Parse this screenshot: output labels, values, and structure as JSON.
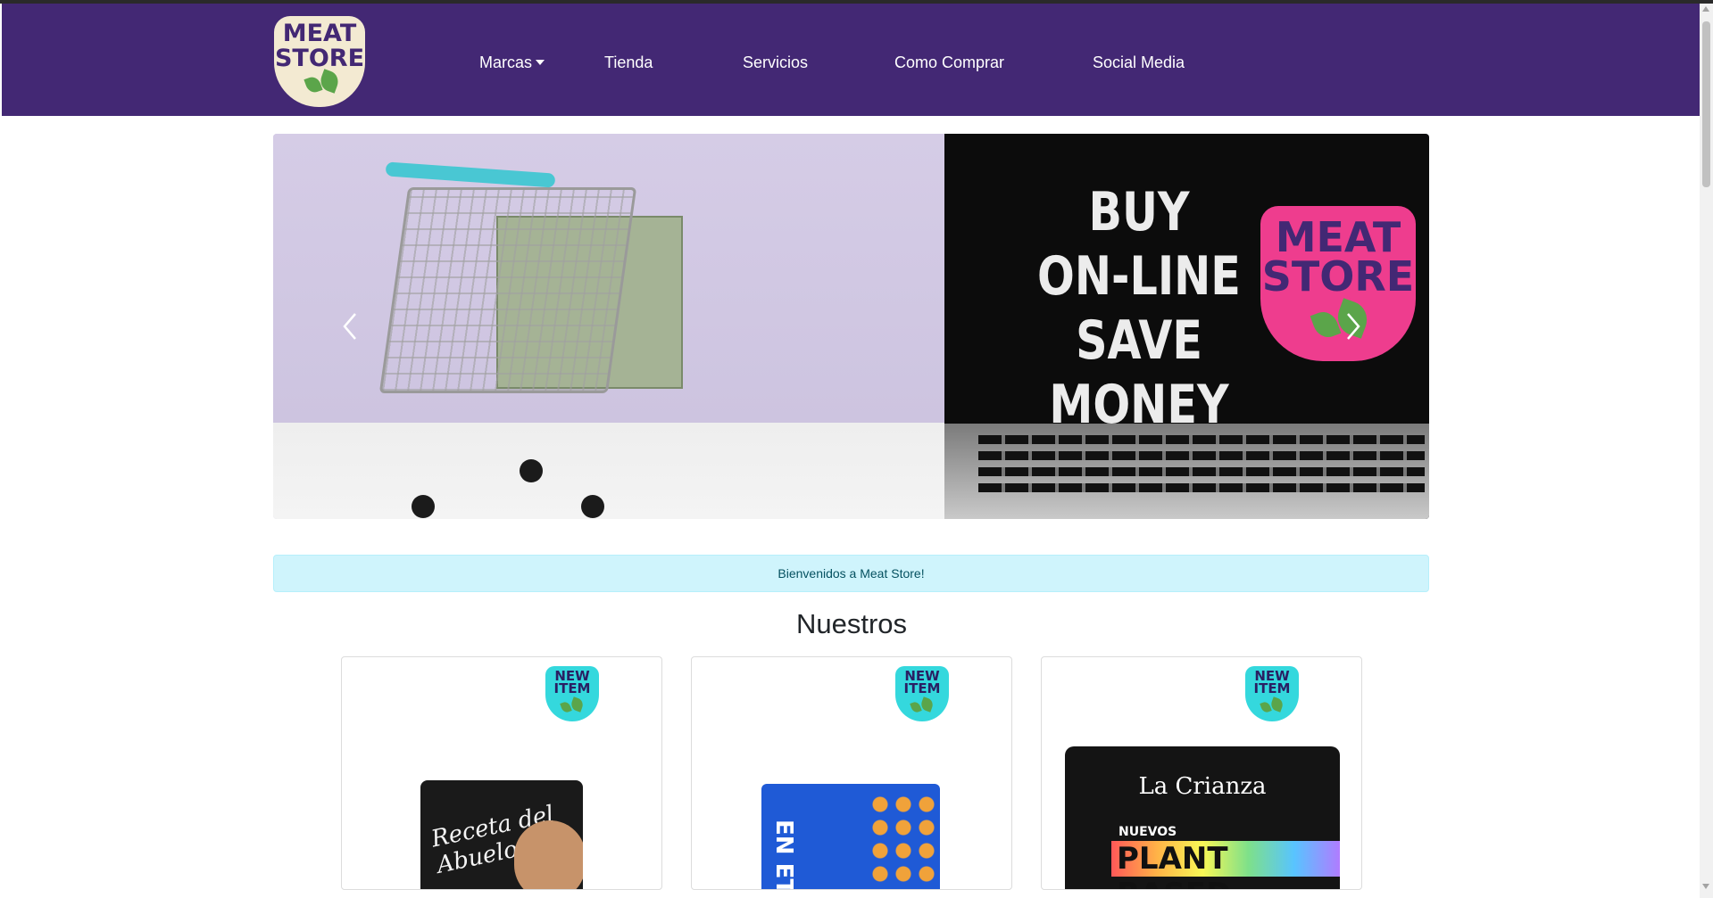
{
  "brand": {
    "logo_line1": "MEAT",
    "logo_line2": "STORE"
  },
  "nav": {
    "items": [
      {
        "label": "Marcas",
        "dropdown": true
      },
      {
        "label": "Tienda"
      },
      {
        "label": "Servicios"
      },
      {
        "label": "Como Comprar"
      },
      {
        "label": "Social Media"
      }
    ]
  },
  "carousel": {
    "line1": "BUY",
    "line2": "ON-LINE",
    "line3": "SAVE MONEY",
    "badge_line1": "MEAT",
    "badge_line2": "STORE"
  },
  "alert": {
    "text": "Bienvenidos a Meat Store!"
  },
  "section": {
    "title": "Nuestros"
  },
  "cards": [
    {
      "badge_line1": "NEW",
      "badge_line2": "ITEM",
      "product_text": "Receta del Abuelo"
    },
    {
      "badge_line1": "NEW",
      "badge_line2": "ITEM",
      "product_text": "EN ETS"
    },
    {
      "badge_line1": "NEW",
      "badge_line2": "ITEM",
      "product_brand": "La Crianza",
      "product_sub": "NUEVOS",
      "product_text": "PLANT BASED"
    }
  ],
  "colors": {
    "nav_bg": "#432874",
    "alert_bg": "#cff4fc",
    "badge_pink": "#ee3d8e",
    "badge_teal": "#34d8dd"
  }
}
